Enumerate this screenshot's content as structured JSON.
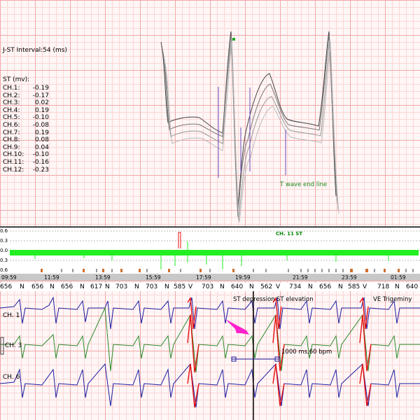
{
  "jst_interval": "J-ST Interval:54 (ms)",
  "st_title": "ST (mv):",
  "st_values": [
    {
      "ch": "CH.1:",
      "val": "-0.19"
    },
    {
      "ch": "CH.2:",
      "val": "-0.17"
    },
    {
      "ch": "CH.3:",
      "val": "0.02"
    },
    {
      "ch": "CH.4:",
      "val": "0.19"
    },
    {
      "ch": "CH.5:",
      "val": "-0.10"
    },
    {
      "ch": "CH.6:",
      "val": "-0.08"
    },
    {
      "ch": "CH.7:",
      "val": "0.19"
    },
    {
      "ch": "CH.8:",
      "val": "0.08"
    },
    {
      "ch": "CH.9:",
      "val": "0.04"
    },
    {
      "ch": "CH.10:",
      "val": "-0.10"
    },
    {
      "ch": "CH.11:",
      "val": "-0.16"
    },
    {
      "ch": "CH.12:",
      "val": "-0.23"
    }
  ],
  "twave_label": "T wave end line",
  "trend": {
    "title": "CH. 11  ST",
    "ylabels": [
      "0.6",
      "0.3",
      "0.0",
      "0.3",
      "0.6"
    ],
    "times": [
      "09:59",
      "11:59",
      "13:59",
      "15:59",
      "17:59",
      "19:59",
      "21:59",
      "23:59",
      "01:59"
    ]
  },
  "rr_row": [
    "656",
    "N",
    "656",
    "N",
    "656",
    "N",
    "617",
    "N",
    "703",
    "N",
    "703",
    "N",
    "585",
    "V",
    "703",
    "N",
    "640",
    "N",
    "562",
    "V",
    "734",
    "N",
    "656",
    "N",
    "585",
    "V",
    "718",
    "N",
    "640"
  ],
  "events": {
    "st_depression": "ST depression",
    "st_elevation": "ST elevation",
    "ve_trigeminy": "VE Trigeminy"
  },
  "channels": [
    "CH. 1",
    "CH. 3",
    "CH. 6"
  ],
  "measure": "1000 ms,60 bpm",
  "colors": {
    "grid_major": "#f0a8a8",
    "trend_green": "#22ee22",
    "pvc_red": "#e81010",
    "arrow": "#ff22cc",
    "ch1": "#1a1aa0",
    "ch3": "#2a8a2a",
    "ch6": "#1a1aa0"
  }
}
